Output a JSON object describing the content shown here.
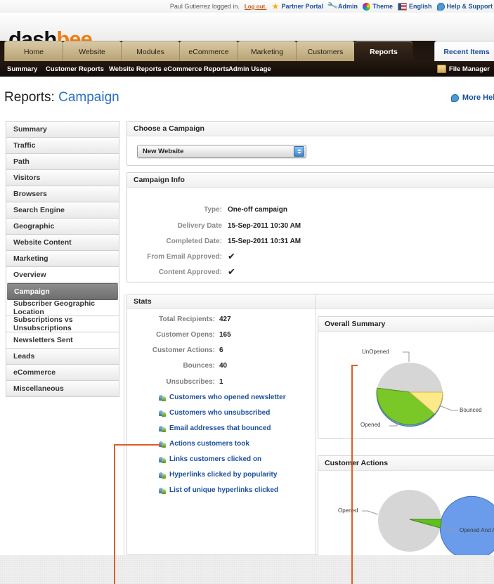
{
  "utilbar": {
    "user_text": "Paul Gutierrez logged in.",
    "logout": "Log out.",
    "links": [
      {
        "label": "Partner Portal",
        "icon": "star-icon"
      },
      {
        "label": "Admin",
        "icon": "wrench-icon"
      },
      {
        "label": "Theme",
        "icon": "color-wheel-icon"
      },
      {
        "label": "English",
        "icon": "flag-icon"
      },
      {
        "label": "Help & Support",
        "icon": "help-bubble-icon"
      }
    ]
  },
  "logo": {
    "part1": "dash",
    "part2": "bee",
    "accent_color": "#f07c11"
  },
  "tabs": [
    {
      "label": "Home",
      "active": false
    },
    {
      "label": "Website",
      "active": false
    },
    {
      "label": "Modules",
      "active": false
    },
    {
      "label": "eCommerce",
      "active": false
    },
    {
      "label": "Marketing",
      "active": false
    },
    {
      "label": "Customers",
      "active": false
    },
    {
      "label": "Reports",
      "active": true
    }
  ],
  "recent_items_tab": "Recent Items",
  "subnav": {
    "items": [
      "Summary",
      "Customer Reports",
      "Website Reports",
      "eCommerce Reports",
      "Admin Usage"
    ],
    "file_manager": "File Manager"
  },
  "page_title": {
    "prefix": "Reports:",
    "current": "Campaign"
  },
  "more_help": "More Help",
  "sidebar": {
    "items": [
      {
        "label": "Summary",
        "level": "top",
        "selected": false
      },
      {
        "label": "Traffic",
        "level": "top",
        "selected": false
      },
      {
        "label": "Path",
        "level": "top",
        "selected": false
      },
      {
        "label": "Visitors",
        "level": "top",
        "selected": false
      },
      {
        "label": "Browsers",
        "level": "top",
        "selected": false
      },
      {
        "label": "Search Engine",
        "level": "top",
        "selected": false
      },
      {
        "label": "Geographic",
        "level": "top",
        "selected": false
      },
      {
        "label": "Website Content",
        "level": "top",
        "selected": false
      },
      {
        "label": "Marketing",
        "level": "top",
        "selected": false
      },
      {
        "label": "Overview",
        "level": "sub",
        "selected": false
      },
      {
        "label": "Campaign",
        "level": "sub",
        "selected": true
      },
      {
        "label": "Subscriber Geographic Location",
        "level": "sub",
        "selected": false
      },
      {
        "label": "Subscriptions vs Unsubscriptions",
        "level": "sub",
        "selected": false
      },
      {
        "label": "Newsletters Sent",
        "level": "sub",
        "selected": false
      },
      {
        "label": "Leads",
        "level": "top",
        "selected": false
      },
      {
        "label": "eCommerce",
        "level": "top",
        "selected": false
      },
      {
        "label": "Miscellaneous",
        "level": "top",
        "selected": false
      }
    ]
  },
  "choose_campaign": {
    "title": "Choose a Campaign",
    "selected": "New Website"
  },
  "campaign_info": {
    "title": "Campaign Info",
    "rows": [
      {
        "label": "Type:",
        "value": "One-off campaign",
        "type": "text"
      },
      {
        "label": "Delivery Date",
        "value": "15-Sep-2011 10:30 AM",
        "type": "text"
      },
      {
        "label": "Completed Date:",
        "value": "15-Sep-2011 10:31 AM",
        "type": "text"
      },
      {
        "label": "From Email Approved:",
        "value": "✔",
        "type": "check"
      },
      {
        "label": "Content Approved:",
        "value": "✔",
        "type": "check"
      }
    ]
  },
  "stats": {
    "title": "Stats",
    "metrics": [
      {
        "label": "Total Recipients:",
        "value": "427"
      },
      {
        "label": "Customer Opens:",
        "value": "165"
      },
      {
        "label": "Customer Actions:",
        "value": "6"
      },
      {
        "label": "Bounces:",
        "value": "40"
      },
      {
        "label": "Unsubscribes:",
        "value": "1"
      }
    ],
    "links": [
      "Customers who opened newsletter",
      "Customers who unsubscribed",
      "Email addresses that bounced",
      "Actions customers took",
      "Links customers clicked on",
      "Hyperlinks clicked by popularity",
      "List of unique hyperlinks clicked"
    ]
  },
  "chart_data": [
    {
      "type": "pie",
      "title": "Overall Summary",
      "categories": [
        "UnOpened",
        "Opened",
        "Bounced"
      ],
      "values": [
        222,
        165,
        40
      ],
      "colors": [
        "#6a9ceb",
        "#79c828",
        "#fbe98a"
      ],
      "legend": "labels-with-leader-lines"
    },
    {
      "type": "pie",
      "title": "Customer Actions",
      "categories": [
        "Opened",
        "Opened And A..."
      ],
      "values": [
        159,
        6
      ],
      "colors": [
        "#6a9ceb",
        "#5fc21a"
      ],
      "legend": "labels-with-leader-lines"
    }
  ]
}
